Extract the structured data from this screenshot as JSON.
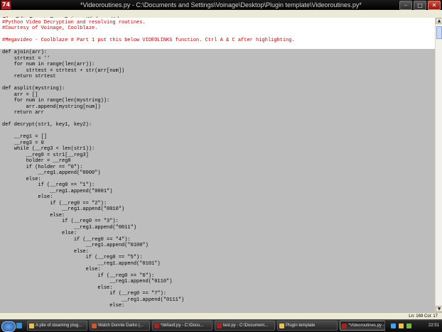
{
  "window": {
    "title": "*Videoroutines.py - C:\\Documents and Settings\\Voinage\\Desktop\\Plugin template\\Videoroutines.py*",
    "app_icon_text": "74"
  },
  "menu": [
    "File",
    "Edit",
    "Format",
    "Run",
    "Options",
    "Windows",
    "Help"
  ],
  "code_lines": [
    {
      "text": "#Python Video Decryption and resolving routines.",
      "kind": "comment"
    },
    {
      "text": "#Courtesy of Voinage, Coolblaze.",
      "kind": "comment"
    },
    {
      "text": "",
      "kind": "code"
    },
    {
      "text": "#Megavideo - Coolblaze # Part 1 put this below VIDEOLINKS function. Ctrl A & C after highlighting.",
      "kind": "comment"
    },
    {
      "text": "",
      "kind": "code"
    },
    {
      "text": "def ajoin(arr):",
      "kind": "code"
    },
    {
      "text": "    strtest = ''",
      "kind": "code"
    },
    {
      "text": "    for num in range(len(arr)):",
      "kind": "code"
    },
    {
      "text": "        strtest = strtest + str(arr[num])",
      "kind": "code"
    },
    {
      "text": "    return strtest",
      "kind": "code"
    },
    {
      "text": "",
      "kind": "code"
    },
    {
      "text": "def asplit(mystring):",
      "kind": "code"
    },
    {
      "text": "    arr = []",
      "kind": "code"
    },
    {
      "text": "    for num in range(len(mystring)):",
      "kind": "code"
    },
    {
      "text": "        arr.append(mystring[num])",
      "kind": "code"
    },
    {
      "text": "    return arr",
      "kind": "code"
    },
    {
      "text": "",
      "kind": "code"
    },
    {
      "text": "def decrypt(str1, key1, key2):",
      "kind": "code"
    },
    {
      "text": "",
      "kind": "code"
    },
    {
      "text": "    __reg1 = []",
      "kind": "code"
    },
    {
      "text": "    __reg3 = 0",
      "kind": "code"
    },
    {
      "text": "    while (__reg3 < len(str1)):",
      "kind": "code"
    },
    {
      "text": "        __reg0 = str1[__reg3]",
      "kind": "code"
    },
    {
      "text": "        holder = __reg0",
      "kind": "code"
    },
    {
      "text": "        if (holder == \"0\"):",
      "kind": "code"
    },
    {
      "text": "            __reg1.append(\"0000\")",
      "kind": "code"
    },
    {
      "text": "        else:",
      "kind": "code"
    },
    {
      "text": "            if (__reg0 == \"1\"):",
      "kind": "code"
    },
    {
      "text": "                __reg1.append(\"0001\")",
      "kind": "code"
    },
    {
      "text": "            else:",
      "kind": "code"
    },
    {
      "text": "                if (__reg0 == \"2\"):",
      "kind": "code"
    },
    {
      "text": "                    __reg1.append(\"0010\")",
      "kind": "code"
    },
    {
      "text": "                else:",
      "kind": "code"
    },
    {
      "text": "                    if (__reg0 == \"3\"):",
      "kind": "code"
    },
    {
      "text": "                        __reg1.append(\"0011\")",
      "kind": "code"
    },
    {
      "text": "                    else:",
      "kind": "code"
    },
    {
      "text": "                        if (__reg0 == \"4\"):",
      "kind": "code"
    },
    {
      "text": "                            __reg1.append(\"0100\")",
      "kind": "code"
    },
    {
      "text": "                        else:",
      "kind": "code"
    },
    {
      "text": "                            if (__reg0 == \"5\"):",
      "kind": "code"
    },
    {
      "text": "                                __reg1.append(\"0101\")",
      "kind": "code"
    },
    {
      "text": "                            else:",
      "kind": "code"
    },
    {
      "text": "                                if (__reg0 == \"6\"):",
      "kind": "code"
    },
    {
      "text": "                                    __reg1.append(\"0110\")",
      "kind": "code"
    },
    {
      "text": "                                else:",
      "kind": "code"
    },
    {
      "text": "                                    if (__reg0 == \"7\"):",
      "kind": "code"
    },
    {
      "text": "                                        __reg1.append(\"0111\")",
      "kind": "code"
    },
    {
      "text": "                                    else:",
      "kind": "code"
    }
  ],
  "selection": {
    "first_line": 5,
    "last_line": 47
  },
  "status": {
    "position": "Ln: 169 Col: 17"
  },
  "taskbar": {
    "tasks": [
      {
        "label": "A pile of steaming plug...",
        "icon": "folder-icon",
        "color": "#e8c24a",
        "active": false
      },
      {
        "label": "Watch Donnie Darko (...",
        "icon": "browser-icon",
        "color": "#d2552c",
        "active": false
      },
      {
        "label": "*default.py - C:\\Docu...",
        "icon": "idle-icon",
        "color": "#b31d1d",
        "active": false
      },
      {
        "label": "test.py - C:\\Document...",
        "icon": "idle-icon",
        "color": "#b31d1d",
        "active": false
      },
      {
        "label": "Plugin template",
        "icon": "folder-icon",
        "color": "#e8c24a",
        "active": false
      },
      {
        "label": "*Videoroutines.py - C...",
        "icon": "idle-icon",
        "color": "#b31d1d",
        "active": true
      }
    ],
    "clock": "22:51"
  },
  "colors": {
    "comment": "#c40000",
    "selection": "#bdbdbd"
  }
}
